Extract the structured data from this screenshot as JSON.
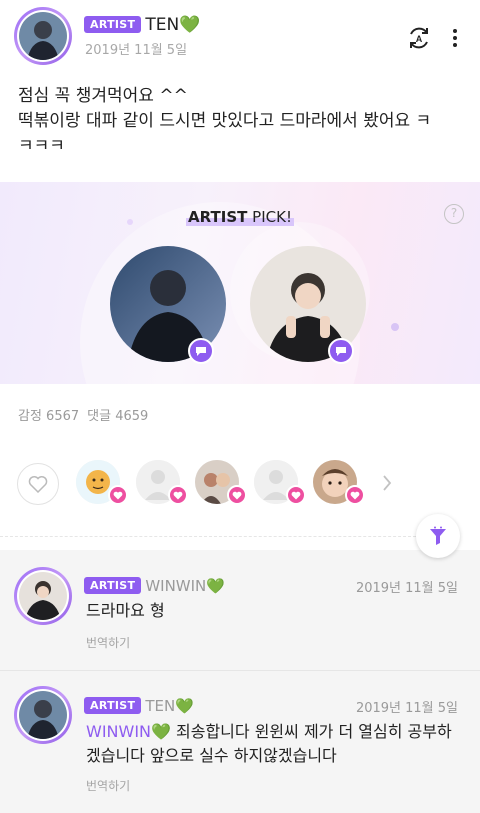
{
  "post": {
    "badge": "ARTIST",
    "author": "TEN💚",
    "date": "2019년 11월 5일",
    "text_line1": "점심 꼭 챙겨먹어요 ^^",
    "text_line2": "떡볶이랑 대파 같이 드시면 맛있다고 드마라에서 봤어요 ㅋ",
    "text_line3": "ㅋㅋㅋ"
  },
  "pick": {
    "title_bold": "ARTIST",
    "title_rest": " PICK!",
    "help": "?"
  },
  "stats": {
    "emotion": "감정 6567",
    "comments": "댓글 4659"
  },
  "comments": [
    {
      "badge": "ARTIST",
      "author": "WINWIN💚",
      "date": "2019년 11월 5일",
      "text": "드라마요 형",
      "translate": "번역하기"
    },
    {
      "badge": "ARTIST",
      "author": "TEN💚",
      "date": "2019년 11월 5일",
      "mention": "WINWIN💚",
      "text": " 죄송합니다 윈윈씨 제가 더 열심히 공부하겠습니다 앞으로 실수 하지않겠습니다",
      "translate": "번역하기"
    }
  ],
  "icons": {
    "translate": "translate-icon",
    "more": "more-vertical-icon",
    "like": "heart-outline-icon",
    "chat": "chat-bubble-icon",
    "heart": "heart-icon",
    "filter": "filter-funnel-icon",
    "next": "chevron-right-icon"
  },
  "colors": {
    "accent": "#8e5cf0",
    "heart": "#ee4fa0"
  }
}
